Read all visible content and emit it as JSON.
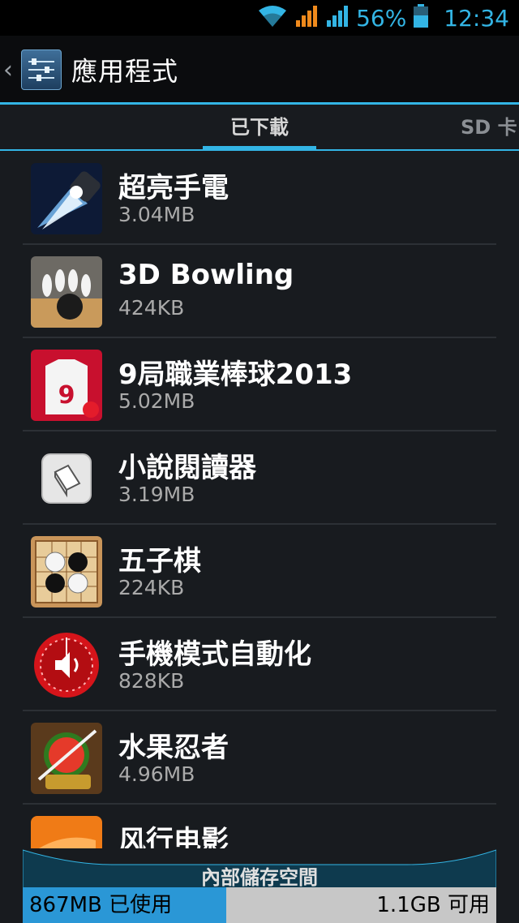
{
  "status_bar": {
    "battery": "56%",
    "time": "12:34",
    "icons": [
      "wifi-icon",
      "signal-icon",
      "signal-icon",
      "battery-icon"
    ]
  },
  "action_bar": {
    "title": "應用程式",
    "up_caret": "‹",
    "app_icon": "settings-sliders-icon"
  },
  "tabs": {
    "active": "已下載",
    "next": "SD 卡"
  },
  "apps": [
    {
      "name": "超亮手電",
      "size": "3.04MB",
      "icon": "flashlight-icon"
    },
    {
      "name": "3D Bowling",
      "size": "424KB",
      "icon": "bowling-icon"
    },
    {
      "name": "9局職業棒球2013",
      "size": "5.02MB",
      "icon": "baseball-jersey-icon"
    },
    {
      "name": "小說閱讀器",
      "size": "3.19MB",
      "icon": "book-icon"
    },
    {
      "name": "五子棋",
      "size": "224KB",
      "icon": "gomoku-icon"
    },
    {
      "name": "手機模式自動化",
      "size": "828KB",
      "icon": "sound-timer-icon"
    },
    {
      "name": "水果忍者",
      "size": "4.96MB",
      "icon": "fruit-ninja-icon"
    },
    {
      "name": "风行电影",
      "size": "",
      "icon": "movie-icon"
    }
  ],
  "storage": {
    "label": "內部儲存空間",
    "used": "867MB 已使用",
    "free": "1.1GB 可用",
    "used_fraction": 0.43
  },
  "colors": {
    "accent": "#33b5e5",
    "background": "#181b1f",
    "status_bar": "#000000",
    "storage_used": "#2a97d6",
    "storage_free": "#c7c7c7"
  }
}
